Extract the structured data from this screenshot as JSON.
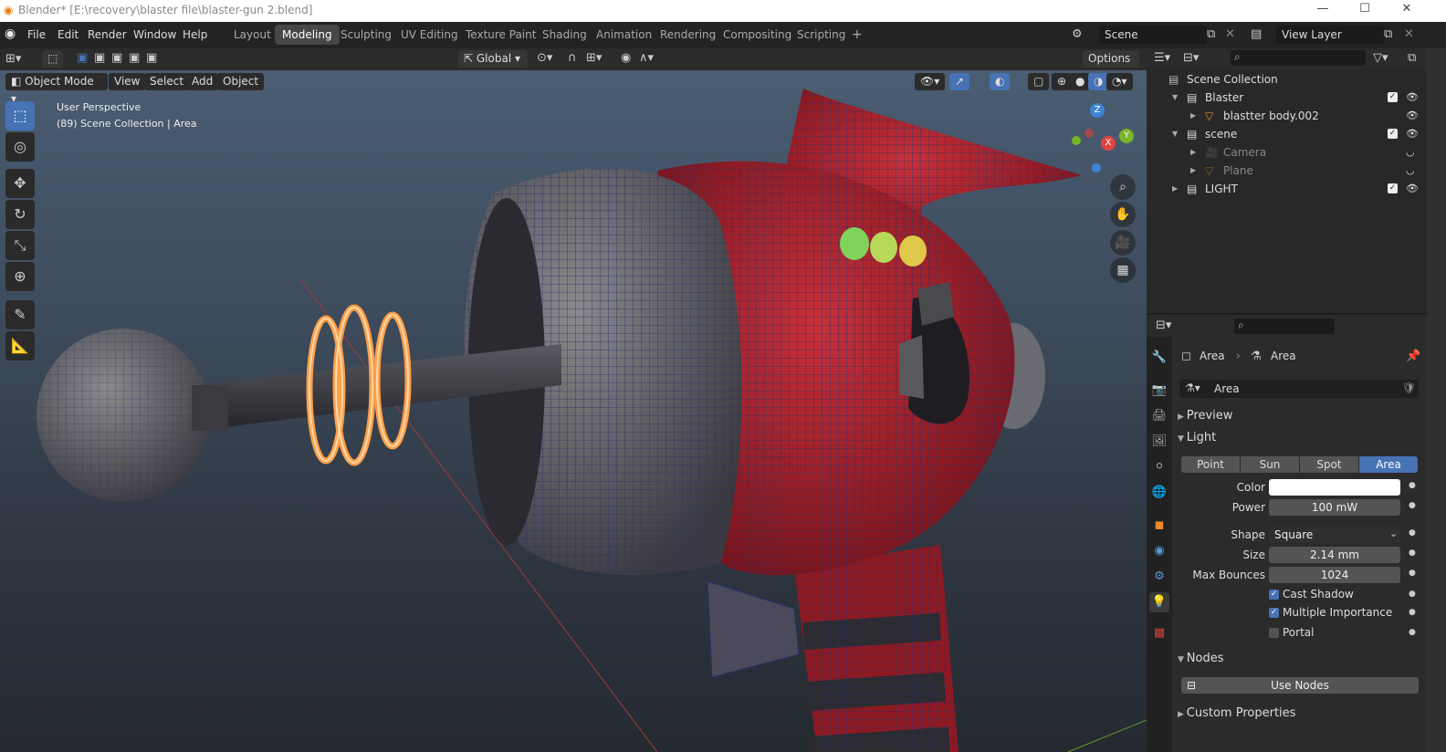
{
  "window": {
    "title": "Blender* [E:\\recovery\\blaster file\\blaster-gun 2.blend]",
    "controls": [
      "—",
      "☐",
      "✕"
    ]
  },
  "menu": [
    "File",
    "Edit",
    "Render",
    "Window",
    "Help"
  ],
  "workspaces": [
    "Layout",
    "Modeling",
    "Sculpting",
    "UV Editing",
    "Texture Paint",
    "Shading",
    "Animation",
    "Rendering",
    "Compositing",
    "Scripting"
  ],
  "workspace_add": "+",
  "scene": {
    "name": "Scene"
  },
  "view_layer": {
    "name": "View Layer"
  },
  "header": {
    "transform_orientation": "Global",
    "options_label": "Options"
  },
  "viewport": {
    "mode": "Object Mode",
    "menus": [
      "View",
      "Select",
      "Add",
      "Object"
    ],
    "overlay_text": [
      "User Perspective",
      "(89) Scene Collection | Area"
    ],
    "gizmo_axes": {
      "x": "X",
      "y": "Y",
      "z": "Z"
    },
    "colors": {
      "x": "#e0453f",
      "y": "#7ab42a",
      "z": "#3d84d6"
    }
  },
  "outliner": {
    "root": "Scene Collection",
    "rows": [
      {
        "label": "Blaster",
        "indent": 1,
        "type": "collection",
        "checked": true,
        "visible": true
      },
      {
        "label": "blastter body.002",
        "indent": 2,
        "type": "mesh",
        "checked": false,
        "visible": true
      },
      {
        "label": "scene",
        "indent": 1,
        "type": "collection",
        "checked": true,
        "visible": true
      },
      {
        "label": "Camera",
        "indent": 2,
        "type": "camera",
        "checked": false,
        "visible": false
      },
      {
        "label": "Plane",
        "indent": 2,
        "type": "mesh",
        "checked": false,
        "visible": false
      },
      {
        "label": "LIGHT",
        "indent": 1,
        "type": "collection",
        "checked": true,
        "visible": true
      }
    ]
  },
  "properties": {
    "breadcrumb": [
      "Area",
      "Area"
    ],
    "datablock": "Area",
    "panels": {
      "preview": "Preview",
      "light": "Light",
      "nodes": "Nodes",
      "custom": "Custom Properties"
    },
    "light_types": [
      "Point",
      "Sun",
      "Spot",
      "Area"
    ],
    "active_type": "Area",
    "fields": [
      {
        "label": "Color",
        "value": ""
      },
      {
        "label": "Power",
        "value": "100 mW"
      },
      {
        "label": "Shape",
        "value": "Square"
      },
      {
        "label": "Size",
        "value": "2.14 mm"
      },
      {
        "label": "Max Bounces",
        "value": "1024"
      }
    ],
    "checkboxes": [
      {
        "label": "Cast Shadow",
        "checked": true
      },
      {
        "label": "Multiple Importance",
        "checked": true
      },
      {
        "label": "Portal",
        "checked": false
      }
    ],
    "use_nodes": "Use Nodes"
  }
}
